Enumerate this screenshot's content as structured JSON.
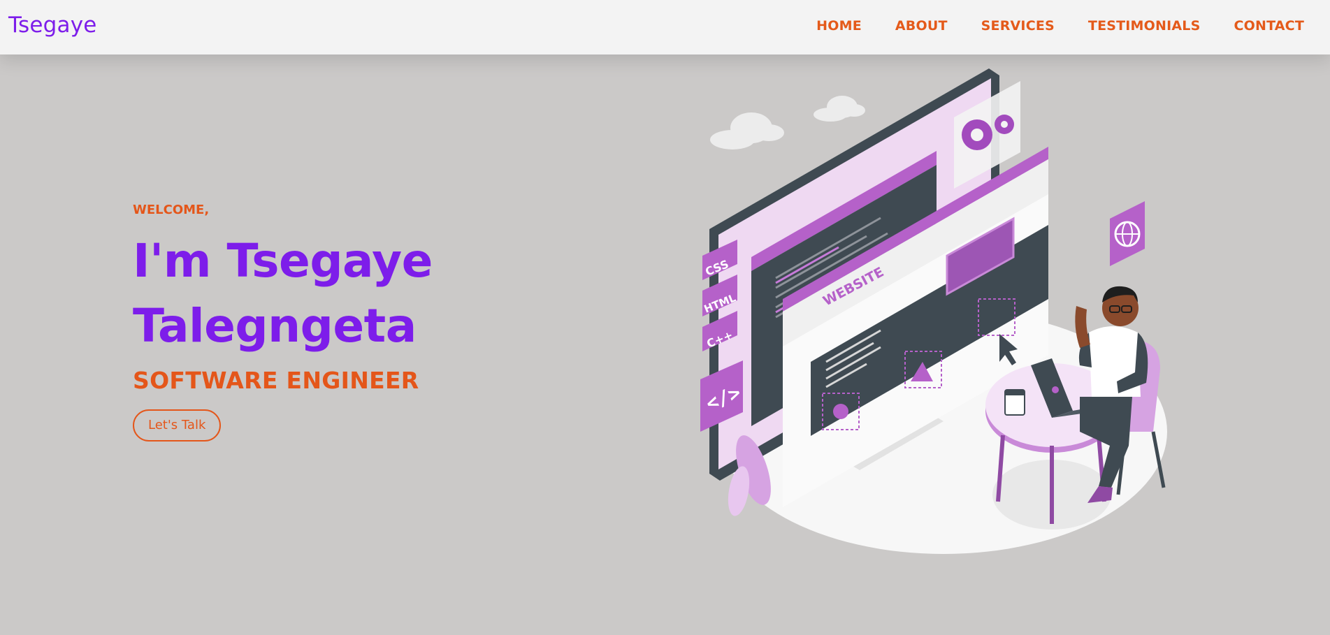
{
  "navbar": {
    "brand": "Tsegaye",
    "links": [
      "HOME",
      "ABOUT",
      "SERVICES",
      "TESTIMONIALS",
      "CONTACT"
    ]
  },
  "hero": {
    "welcome": "WELCOME,",
    "name_line1": "I'm Tsegaye",
    "name_line2": "Talegngeta",
    "role": "SOFTWARE ENGINEER",
    "cta": "Let's Talk"
  },
  "illustration": {
    "badges": [
      "CSS",
      "HTML",
      "C++"
    ],
    "website_label": "WEBSITE"
  },
  "colors": {
    "accent_purple": "#7d1dea",
    "accent_orange": "#e4561a",
    "background": "#cbc9c8",
    "navbar_bg": "#f3f3f3"
  }
}
